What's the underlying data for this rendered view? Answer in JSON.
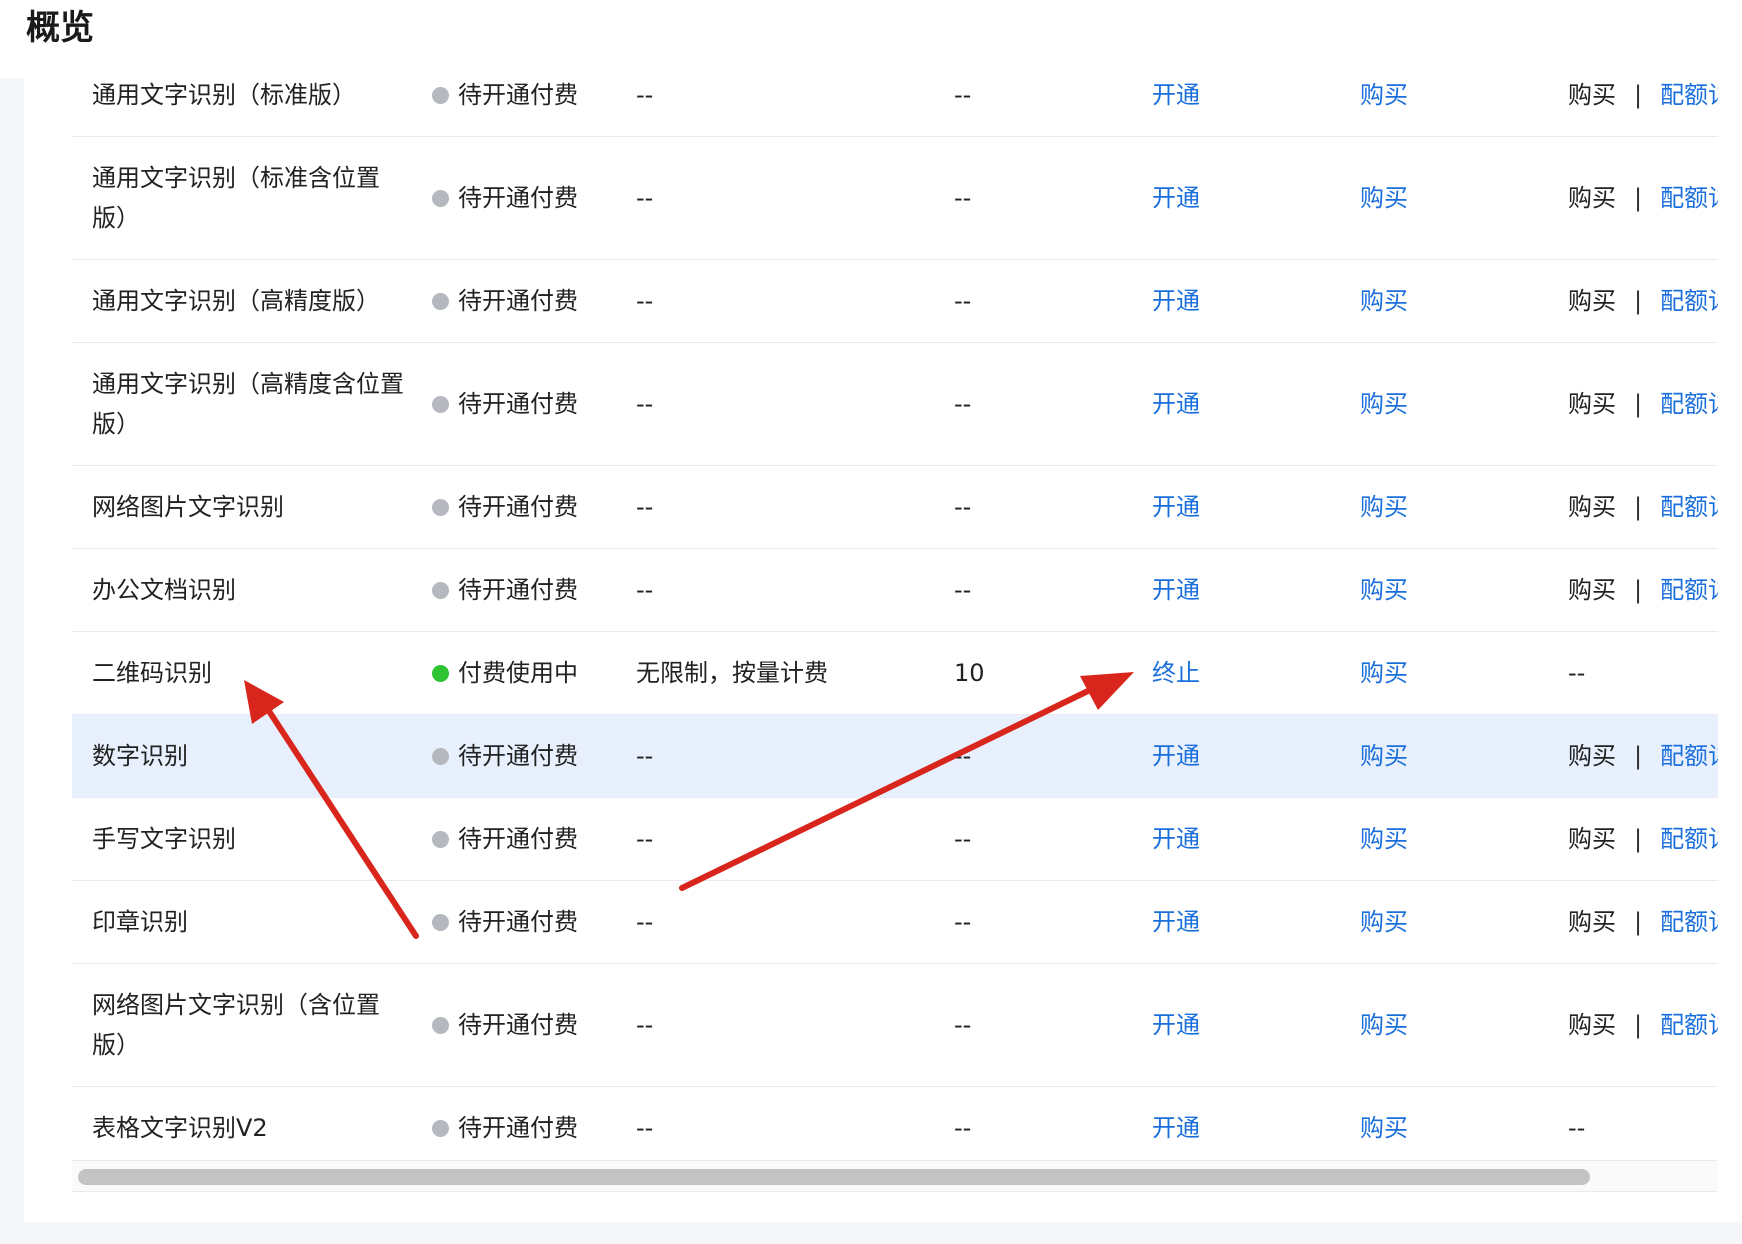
{
  "header": {
    "title": "概览"
  },
  "rows": [
    {
      "name": "通用文字识别（标准版）",
      "status": "待开通付费",
      "status_color": "#b6b8bf",
      "quota": "--",
      "used": "--",
      "op1": "开通",
      "op2": "购买",
      "op3_a": "购买",
      "op3_sep": "|",
      "op3_b": "配额详"
    },
    {
      "name": "通用文字识别（标准含位置版）",
      "status": "待开通付费",
      "status_color": "#b6b8bf",
      "quota": "--",
      "used": "--",
      "op1": "开通",
      "op2": "购买",
      "op3_a": "购买",
      "op3_sep": "|",
      "op3_b": "配额详"
    },
    {
      "name": "通用文字识别（高精度版）",
      "status": "待开通付费",
      "status_color": "#b6b8bf",
      "quota": "--",
      "used": "--",
      "op1": "开通",
      "op2": "购买",
      "op3_a": "购买",
      "op3_sep": "|",
      "op3_b": "配额详"
    },
    {
      "name": "通用文字识别（高精度含位置版）",
      "status": "待开通付费",
      "status_color": "#b6b8bf",
      "quota": "--",
      "used": "--",
      "op1": "开通",
      "op2": "购买",
      "op3_a": "购买",
      "op3_sep": "|",
      "op3_b": "配额详"
    },
    {
      "name": "网络图片文字识别",
      "status": "待开通付费",
      "status_color": "#b6b8bf",
      "quota": "--",
      "used": "--",
      "op1": "开通",
      "op2": "购买",
      "op3_a": "购买",
      "op3_sep": "|",
      "op3_b": "配额详"
    },
    {
      "name": "办公文档识别",
      "status": "待开通付费",
      "status_color": "#b6b8bf",
      "quota": "--",
      "used": "--",
      "op1": "开通",
      "op2": "购买",
      "op3_a": "购买",
      "op3_sep": "|",
      "op3_b": "配额详"
    },
    {
      "name": "二维码识别",
      "status": "付费使用中",
      "status_color": "#2ec333",
      "quota": "无限制，按量计费",
      "used": "10",
      "op1": "终止",
      "op2": "购买",
      "op3_text": "--"
    },
    {
      "name": "数字识别",
      "status": "待开通付费",
      "status_color": "#b6b8bf",
      "quota": "--",
      "used": "--",
      "op1": "开通",
      "op2": "购买",
      "op3_a": "购买",
      "op3_sep": "|",
      "op3_b": "配额详"
    },
    {
      "name": "手写文字识别",
      "status": "待开通付费",
      "status_color": "#b6b8bf",
      "quota": "--",
      "used": "--",
      "op1": "开通",
      "op2": "购买",
      "op3_a": "购买",
      "op3_sep": "|",
      "op3_b": "配额详"
    },
    {
      "name": "印章识别",
      "status": "待开通付费",
      "status_color": "#b6b8bf",
      "quota": "--",
      "used": "--",
      "op1": "开通",
      "op2": "购买",
      "op3_a": "购买",
      "op3_sep": "|",
      "op3_b": "配额详"
    },
    {
      "name": "网络图片文字识别（含位置版）",
      "status": "待开通付费",
      "status_color": "#b6b8bf",
      "quota": "--",
      "used": "--",
      "op1": "开通",
      "op2": "购买",
      "op3_a": "购买",
      "op3_sep": "|",
      "op3_b": "配额详"
    },
    {
      "name": "表格文字识别V2",
      "status": "待开通付费",
      "status_color": "#b6b8bf",
      "quota": "--",
      "used": "--",
      "op1": "开通",
      "op2": "购买",
      "op3_text": "--"
    }
  ],
  "colors": {
    "link": "#1a6fdc",
    "highlight_row": "#e8f0fd",
    "annotation_arrow": "#d9261c"
  }
}
